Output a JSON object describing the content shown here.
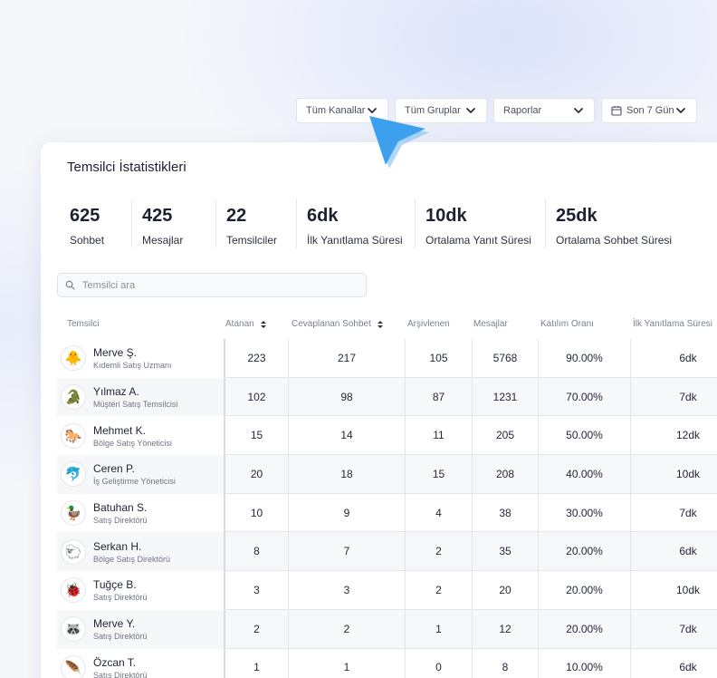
{
  "filters": {
    "channels": "Tüm Kanallar",
    "groups": "Tüm Gruplar",
    "reports": "Raporlar",
    "range": "Son 7 Gün"
  },
  "card": {
    "title": "Temsilci İstatistikleri"
  },
  "stats": [
    {
      "value": "625",
      "label": "Sohbet"
    },
    {
      "value": "425",
      "label": "Mesajlar"
    },
    {
      "value": "22",
      "label": "Temsilciler"
    },
    {
      "value": "6dk",
      "label": "İlk Yanıtlama Süresi"
    },
    {
      "value": "10dk",
      "label": "Ortalama Yanıt Süresi"
    },
    {
      "value": "25dk",
      "label": "Ortalama Sohbet Süresi"
    }
  ],
  "search": {
    "placeholder": "Temsilci ara"
  },
  "table": {
    "headers": [
      "Temsilci",
      "Atanan",
      "Cevaplanan Sohbet",
      "Arşivlenen",
      "Mesajlar",
      "Katılım Oranı",
      "İlk Yanıtlama Süresi"
    ],
    "rows": [
      {
        "name": "Merve Ş.",
        "role": "Kıdemli Satış Uzmanı",
        "avatar": "chick-icon",
        "avatar_glyph": "🐥",
        "assigned": "223",
        "answered": "217",
        "archived": "105",
        "messages": "5768",
        "rate": "90.00%",
        "first": "6dk"
      },
      {
        "name": "Yılmaz A.",
        "role": "Müşteri Satış Temsilcisi",
        "avatar": "crocodile-icon",
        "avatar_glyph": "🐊",
        "assigned": "102",
        "answered": "98",
        "archived": "87",
        "messages": "1231",
        "rate": "70.00%",
        "first": "7dk"
      },
      {
        "name": "Mehmet K.",
        "role": "Bölge Satış Yöneticisi",
        "avatar": "horse-icon",
        "avatar_glyph": "🐎",
        "assigned": "15",
        "answered": "14",
        "archived": "11",
        "messages": "205",
        "rate": "50.00%",
        "first": "12dk"
      },
      {
        "name": "Ceren P.",
        "role": "İş Geliştirme Yöneticisi",
        "avatar": "dolphin-icon",
        "avatar_glyph": "🐬",
        "assigned": "20",
        "answered": "18",
        "archived": "15",
        "messages": "208",
        "rate": "40.00%",
        "first": "10dk"
      },
      {
        "name": "Batuhan S.",
        "role": "Satış Direktörü",
        "avatar": "duck-icon",
        "avatar_glyph": "🦆",
        "assigned": "10",
        "answered": "9",
        "archived": "4",
        "messages": "38",
        "rate": "30.00%",
        "first": "7dk"
      },
      {
        "name": "Serkan H.",
        "role": "Bölge Satış Direktörü",
        "avatar": "sheep-icon",
        "avatar_glyph": "🐑",
        "assigned": "8",
        "answered": "7",
        "archived": "2",
        "messages": "35",
        "rate": "20.00%",
        "first": "6dk"
      },
      {
        "name": "Tuğçe B.",
        "role": "Satış Direktörü",
        "avatar": "ladybug-icon",
        "avatar_glyph": "🐞",
        "assigned": "3",
        "answered": "3",
        "archived": "2",
        "messages": "20",
        "rate": "20.00%",
        "first": "10dk"
      },
      {
        "name": "Merve Y.",
        "role": "Satış Direktörü",
        "avatar": "raccoon-icon",
        "avatar_glyph": "🦝",
        "assigned": "2",
        "answered": "2",
        "archived": "1",
        "messages": "12",
        "rate": "20.00%",
        "first": "7dk"
      },
      {
        "name": "Özcan T.",
        "role": "Satış Direktörü",
        "avatar": "feather-icon",
        "avatar_glyph": "🪶",
        "assigned": "1",
        "answered": "1",
        "archived": "0",
        "messages": "8",
        "rate": "10.00%",
        "first": "6dk"
      }
    ]
  }
}
